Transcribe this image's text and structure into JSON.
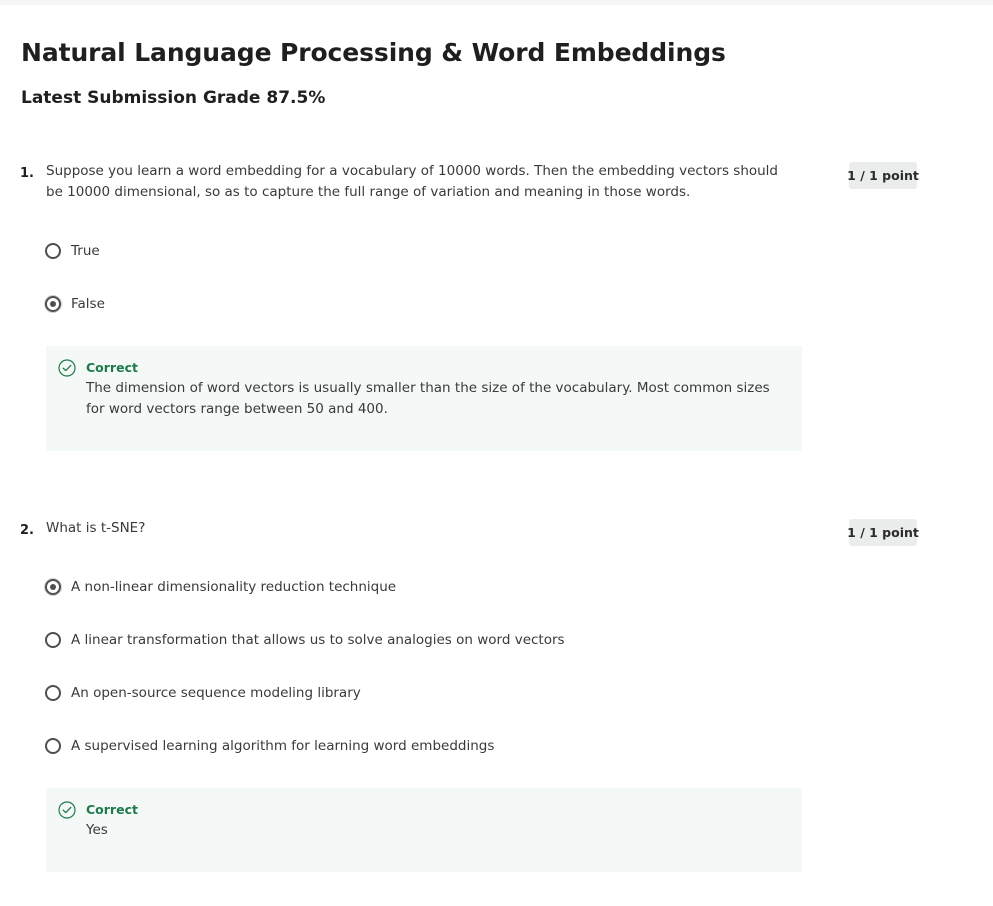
{
  "page": {
    "title": "Natural Language Processing & Word Embeddings",
    "grade": "Latest Submission Grade 87.5%"
  },
  "questions": [
    {
      "number": "1.",
      "text": "Suppose you learn a word embedding for a vocabulary of 10000 words. Then the embedding vectors should be 10000 dimensional, so as to capture the full range of variation and meaning in those words.",
      "points": "1 / 1 point",
      "options": [
        {
          "label": "True",
          "selected": false
        },
        {
          "label": "False",
          "selected": true
        }
      ],
      "feedback": {
        "icon": "check-circle-icon",
        "title": "Correct",
        "text": "The dimension of word vectors is usually smaller than the size of the vocabulary. Most common sizes for word vectors range between 50 and 400."
      }
    },
    {
      "number": "2.",
      "text": "What is t-SNE?",
      "points": "1 / 1 point",
      "options": [
        {
          "label": "A non-linear dimensionality reduction technique",
          "selected": true
        },
        {
          "label": "A linear transformation that allows us to solve analogies on word vectors",
          "selected": false
        },
        {
          "label": "An open-source sequence modeling library",
          "selected": false
        },
        {
          "label": "A supervised learning algorithm for learning word embeddings",
          "selected": false
        }
      ],
      "feedback": {
        "icon": "check-circle-icon",
        "title": "Correct",
        "text": "Yes"
      }
    }
  ],
  "colors": {
    "correct": "#1f7a4a",
    "feedback_bg": "#f4f8f7",
    "points_bg": "#eaedec"
  }
}
